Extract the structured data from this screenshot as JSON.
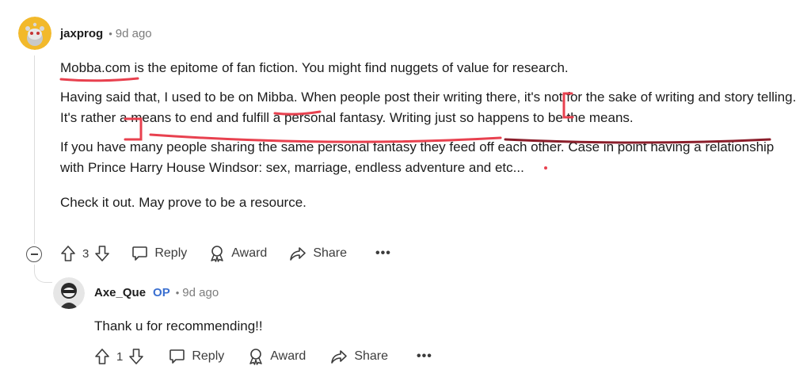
{
  "comment": {
    "username": "jaxprog",
    "timestamp": "9d ago",
    "paragraphs": [
      "Mobba.com is the epitome of fan fiction. You might find nuggets of value for research.",
      "Having said that, I used to be on Mibba. When people post their writing there, it's not for the sake of writing and story telling. It's rather a means to end and fulfill a personal fantasy. Writing just so happens to be the means.",
      "If you have many people sharing the same personal fantasy they feed off each other. Case in point having a relationship with Prince Harry House Windsor: sex, marriage, endless adventure and etc...",
      "Check it out. May prove to be a resource."
    ],
    "actions": {
      "vote_count": "3",
      "reply": "Reply",
      "award": "Award",
      "share": "Share",
      "more": "•••"
    }
  },
  "reply": {
    "username": "Axe_Que",
    "badge": "OP",
    "timestamp": "9d ago",
    "text": "Thank u for recommending!!",
    "actions": {
      "vote_count": "1",
      "reply": "Reply",
      "award": "Award",
      "share": "Share",
      "more": "•••"
    }
  },
  "colors": {
    "annotation_red": "#e8414f",
    "annotation_dark_red": "#8b1e2b",
    "op_blue": "#3a6fd0",
    "avatar_yellow": "#f2b92b"
  },
  "icons": [
    "upvote-icon",
    "downvote-icon",
    "reply-bubble-icon",
    "award-icon",
    "share-arrow-icon",
    "more-dots-icon",
    "collapse-icon"
  ]
}
